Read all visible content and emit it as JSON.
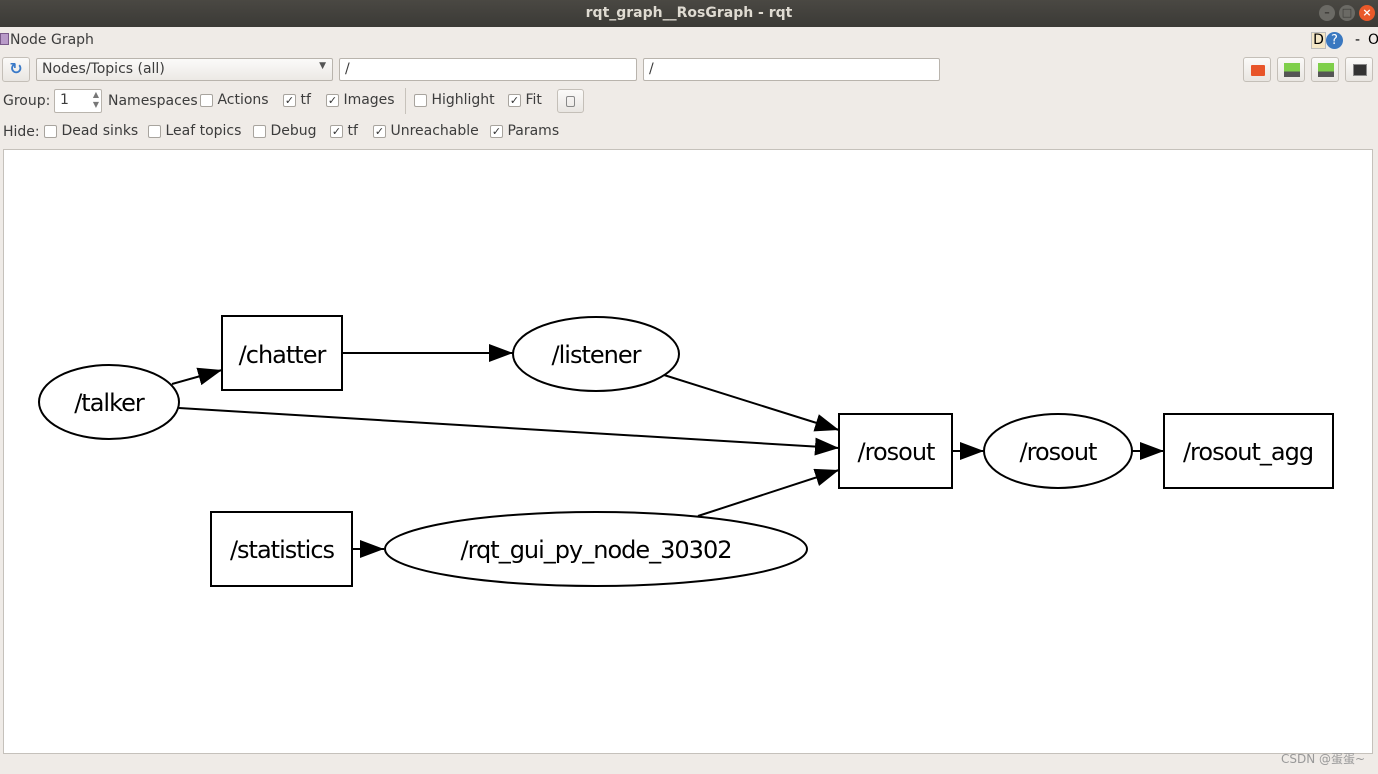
{
  "window": {
    "title": "rqt_graph__RosGraph - rqt"
  },
  "plugin": {
    "title": "Node Graph",
    "d_label": "D",
    "help_label": "?",
    "dash": "-",
    "o": "O"
  },
  "toolbar": {
    "mode_select": "Nodes/Topics (all)",
    "node_filter": "/",
    "topic_filter": "/",
    "group_label": "Group:",
    "group_value": "1",
    "namespaces": {
      "label": "Namespaces"
    },
    "actions": {
      "label": "Actions",
      "checked": false
    },
    "tf": {
      "label": "tf",
      "checked": true
    },
    "images": {
      "label": "Images",
      "checked": true
    },
    "highlight": {
      "label": "Highlight",
      "checked": false
    },
    "fit": {
      "label": "Fit",
      "checked": true
    }
  },
  "hide": {
    "label": "Hide:",
    "items": [
      {
        "label": "Dead sinks",
        "checked": false
      },
      {
        "label": "Leaf topics",
        "checked": false
      },
      {
        "label": "Debug",
        "checked": false
      },
      {
        "label": "tf",
        "checked": true
      },
      {
        "label": "Unreachable",
        "checked": true
      },
      {
        "label": "Params",
        "checked": true
      }
    ]
  },
  "graph": {
    "nodes": {
      "talker": "/talker",
      "chatter": "/chatter",
      "listener": "/listener",
      "rosout_topic": "/rosout",
      "rosout_node": "/rosout",
      "rosout_agg": "/rosout_agg",
      "statistics": "/statistics",
      "rqt_gui": "/rqt_gui_py_node_30302"
    }
  },
  "watermark": "CSDN @蛋蛋~"
}
